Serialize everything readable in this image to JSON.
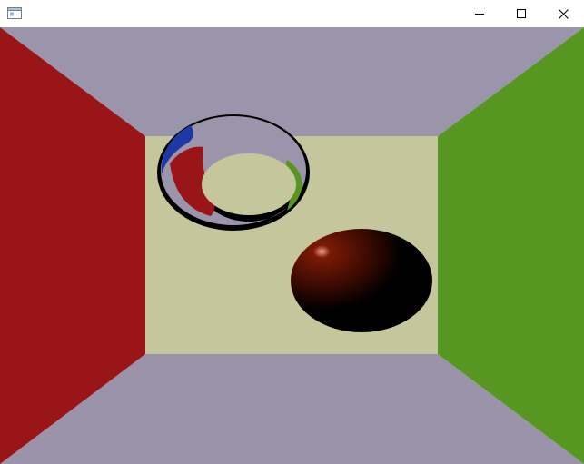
{
  "window": {
    "title": "",
    "icons": {
      "app": "window-app-icon",
      "minimize": "minimize-icon",
      "maximize": "maximize-icon",
      "close": "close-icon"
    }
  },
  "scene": {
    "colors": {
      "ceiling": "#9b95ab",
      "floor": "#9a93a9",
      "back_wall": "#c5c69b",
      "left_wall": "#9a1518",
      "right_wall": "#589622",
      "ring_outer": "#000000",
      "ring_blue": "#1d39a4",
      "ring_red": "#9a1518",
      "ring_green": "#589622",
      "sphere_base": "#000000",
      "sphere_diffuse": "#7a1a05",
      "sphere_highlight": "#f2a08a"
    }
  }
}
